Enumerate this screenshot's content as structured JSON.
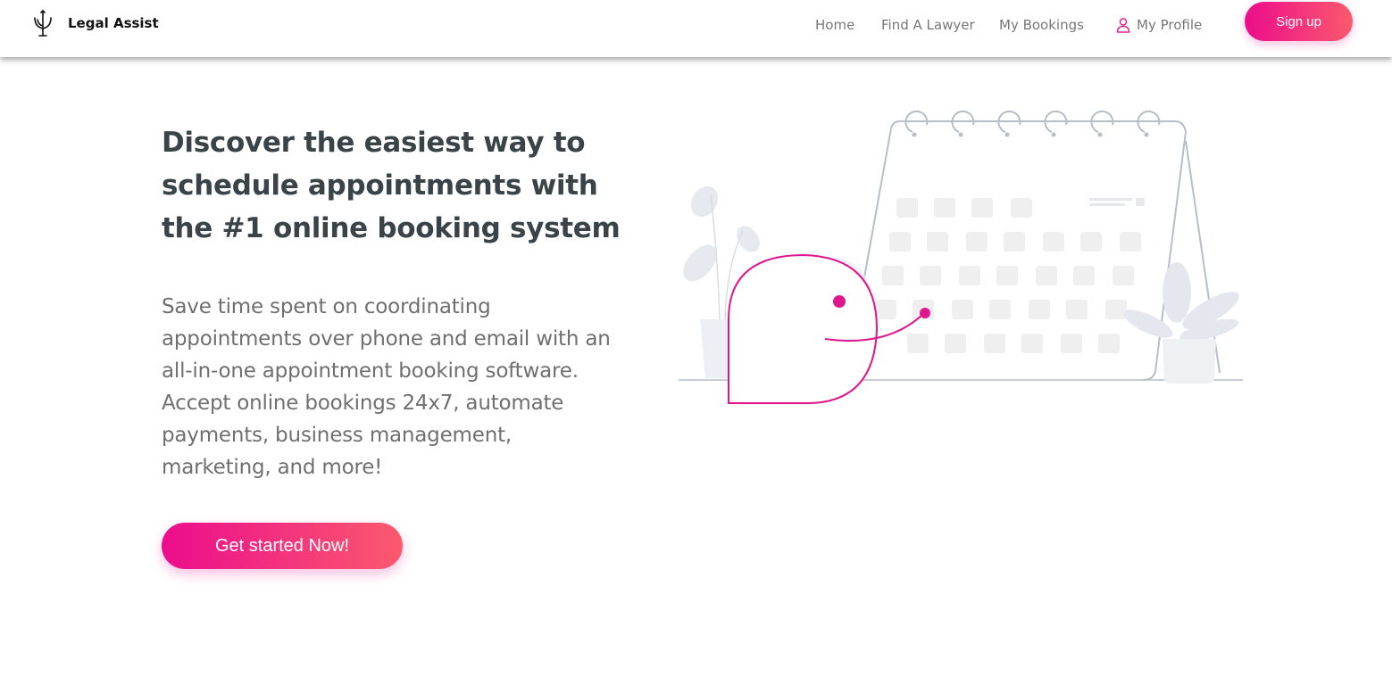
{
  "nav": {
    "brand": "Legal Assist",
    "brand_icon": "trident-icon",
    "links": {
      "home": "Home",
      "find_lawyer": "Find A Lawyer",
      "bookings": "My Bookings",
      "profile": "My Profile"
    },
    "profile_icon": "user-icon",
    "signup": "Sign up"
  },
  "hero": {
    "title": "Discover the easiest way to schedule appointments with the #1 online booking system",
    "description": "Save time spent on coordinating appointments over phone and email with an all-in-one appointment booking software. Accept online bookings 24x7, automate payments, business management, marketing, and more!",
    "cta": "Get started Now!"
  },
  "colors": {
    "accent_start": "#ec0c8c",
    "accent_end": "#fb5a6e",
    "heading": "#3a4448",
    "body_text": "#6f6f6f",
    "nav_text": "#777777"
  }
}
